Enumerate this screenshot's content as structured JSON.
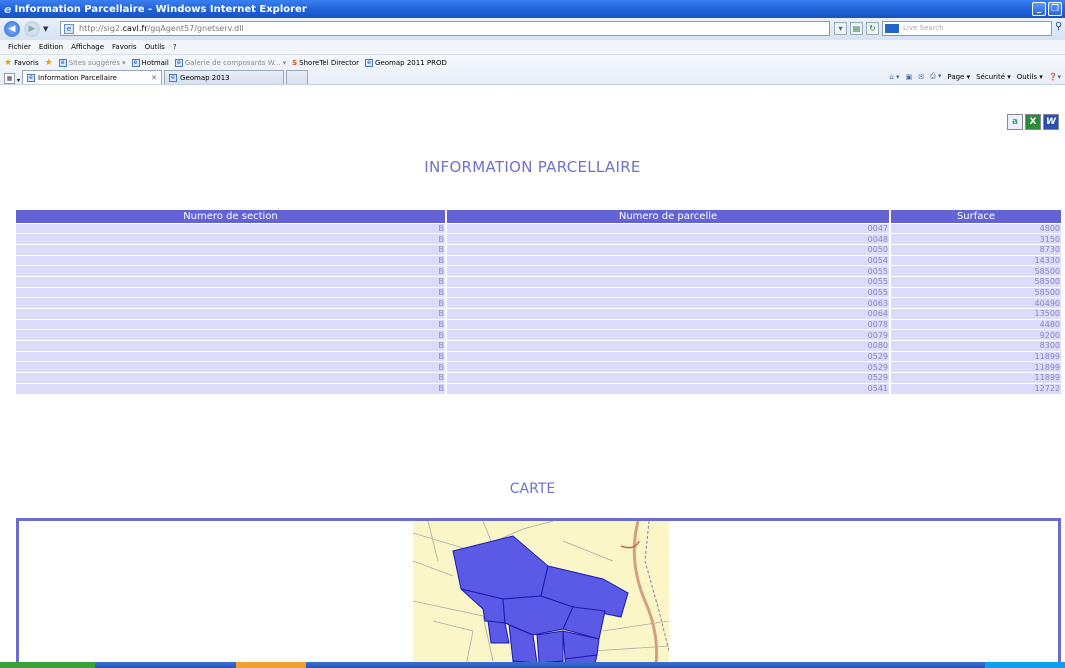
{
  "window": {
    "title": "Information Parcellaire - Windows Internet Explorer"
  },
  "address": {
    "url_prefix": "http://sig2.",
    "url_domain": "cavl.fr",
    "url_suffix": "/gqAgent57/gnetserv.dll",
    "search_placeholder": "Live Search"
  },
  "menu": [
    "Fichier",
    "Edition",
    "Affichage",
    "Favoris",
    "Outils",
    "?"
  ],
  "favorites": {
    "label": "Favoris",
    "items": [
      {
        "label": "Sites suggérés",
        "dim": true
      },
      {
        "label": "Hotmail",
        "dim": false
      },
      {
        "label": "Galerie de composants W...",
        "dim": true
      },
      {
        "label": "ShoreTel Director",
        "dim": false
      },
      {
        "label": "Geomap 2011 PROD",
        "dim": false
      }
    ]
  },
  "tabs": [
    {
      "label": "Information Parcellaire",
      "active": true
    },
    {
      "label": "Geomap 2013",
      "active": false
    }
  ],
  "commands": [
    "Page",
    "Sécurité",
    "Outils"
  ],
  "page": {
    "title": "INFORMATION PARCELLAIRE",
    "map_title": "CARTE"
  },
  "table": {
    "headers": [
      "Numero de section",
      "Numero de parcelle",
      "Surface"
    ],
    "rows": [
      [
        "B",
        "0047",
        "4800"
      ],
      [
        "B",
        "0048",
        "3150"
      ],
      [
        "B",
        "0050",
        "8730"
      ],
      [
        "B",
        "0054",
        "14330"
      ],
      [
        "B",
        "0055",
        "58500"
      ],
      [
        "B",
        "0055",
        "58500"
      ],
      [
        "B",
        "0055",
        "58500"
      ],
      [
        "B",
        "0063",
        "40490"
      ],
      [
        "B",
        "0064",
        "13500"
      ],
      [
        "B",
        "0078",
        "4480"
      ],
      [
        "B",
        "0079",
        "9200"
      ],
      [
        "B",
        "0080",
        "8300"
      ],
      [
        "B",
        "0529",
        "11899"
      ],
      [
        "B",
        "0529",
        "11899"
      ],
      [
        "B",
        "0529",
        "11899"
      ],
      [
        "B",
        "0541",
        "12722"
      ]
    ]
  },
  "colors": {
    "header_bg": "#6363d6",
    "row_bg": "#dcdcfa",
    "row_text": "#8585c4",
    "title_text": "#7070d0",
    "parcel_fill": "#5a5ae6",
    "map_bg": "#fbf6c8"
  }
}
